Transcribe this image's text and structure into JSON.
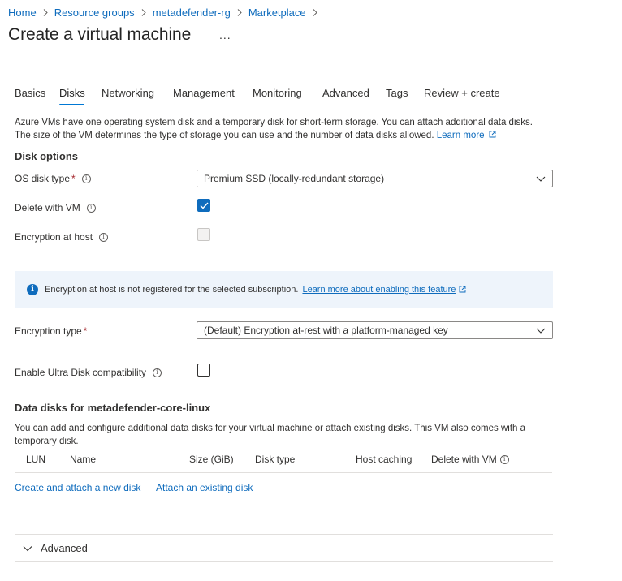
{
  "breadcrumb": [
    "Home",
    "Resource groups",
    "metadefender-rg",
    "Marketplace"
  ],
  "page_title": "Create a virtual machine",
  "more_label": "...",
  "tabs": [
    {
      "label": "Basics"
    },
    {
      "label": "Disks"
    },
    {
      "label": "Networking"
    },
    {
      "label": "Management"
    },
    {
      "label": "Monitoring"
    },
    {
      "label": "Advanced"
    },
    {
      "label": "Tags"
    },
    {
      "label": "Review + create"
    }
  ],
  "active_tab": "Disks",
  "description": "Azure VMs have one operating system disk and a temporary disk for short-term storage. You can attach additional data disks. The size of the VM determines the type of storage you can use and the number of data disks allowed.",
  "description_link": "Learn more",
  "disk_options": {
    "heading": "Disk options",
    "os_disk_type_label": "OS disk type",
    "os_disk_type_value": "Premium SSD (locally-redundant storage)",
    "delete_with_vm_label": "Delete with VM",
    "delete_with_vm_checked": true,
    "encryption_at_host_label": "Encryption at host",
    "encryption_at_host_checked": false
  },
  "banner": {
    "text": "Encryption at host is not registered for the selected subscription.",
    "link": "Learn more about enabling this feature"
  },
  "encryption_type": {
    "label": "Encryption type",
    "value": "(Default) Encryption at-rest with a platform-managed key"
  },
  "ultra_disk": {
    "label": "Enable Ultra Disk compatibility",
    "checked": false
  },
  "data_disks": {
    "heading": "Data disks for metadefender-core-linux",
    "description": "You can add and configure additional data disks for your virtual machine or attach existing disks. This VM also comes with a temporary disk.",
    "columns": [
      "LUN",
      "Name",
      "Size (GiB)",
      "Disk type",
      "Host caching",
      "Delete with VM"
    ],
    "create_link": "Create and attach a new disk",
    "attach_link": "Attach an existing disk"
  },
  "advanced_section": "Advanced",
  "colors": {
    "accent": "#0078d4",
    "link": "#0f6cbd",
    "required": "#a4262c",
    "banner_bg": "#eef4fb"
  }
}
